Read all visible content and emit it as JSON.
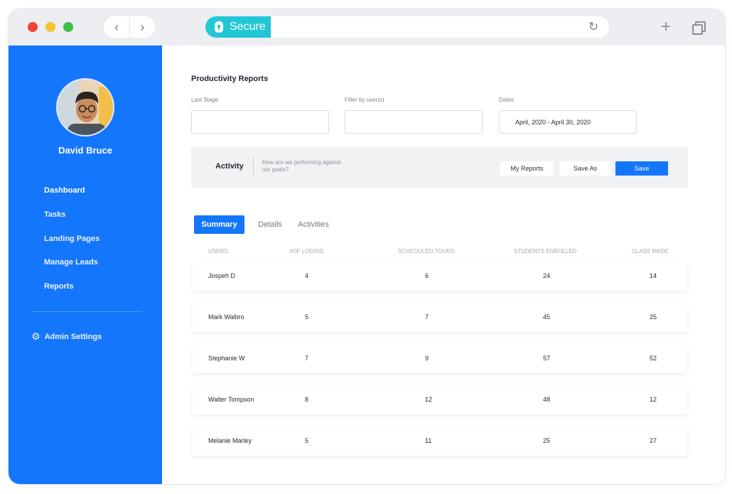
{
  "browser": {
    "secure_label": "Secure",
    "back_icon": "‹",
    "forward_icon": "›",
    "reload_icon": "↻",
    "newtab_icon": "+"
  },
  "sidebar": {
    "user_name": "David Bruce",
    "items": [
      {
        "label": "Dashboard"
      },
      {
        "label": "Tasks"
      },
      {
        "label": "Landing Pages"
      },
      {
        "label": "Manage Leads"
      },
      {
        "label": "Reports"
      }
    ],
    "admin_label": "Admin Settings"
  },
  "main": {
    "title": "Productivity Reports",
    "filters": {
      "last_stage_label": "Last Stage",
      "last_stage_value": "",
      "users_label": "Filter by user(s)",
      "users_value": "",
      "dates_label": "Dates",
      "dates_value": "April, 2020 - April 30, 2020"
    },
    "activity": {
      "title": "Activity",
      "subtitle": "How are we performing against our goals?",
      "my_reports": "My Reports",
      "save_as": "Save As",
      "save": "Save"
    },
    "tabs": [
      {
        "label": "Summary"
      },
      {
        "label": "Details"
      },
      {
        "label": "Activities"
      }
    ],
    "table": {
      "headers": [
        "USERS",
        "#OF LOGINS",
        "SCHEDULED TOURS",
        "STUDENTS ENROLLED",
        "CLASS MADE"
      ],
      "rows": [
        [
          "Jospeh D",
          "4",
          "6",
          "24",
          "14"
        ],
        [
          "Mark Walbro",
          "5",
          "7",
          "45",
          "25"
        ],
        [
          "Stephanie W",
          "7",
          "9",
          "57",
          "52"
        ],
        [
          "Walter Tompson",
          "8",
          "12",
          "48",
          "12"
        ],
        [
          "Melanie Marley",
          "5",
          "11",
          "25",
          "27"
        ]
      ]
    }
  },
  "colors": {
    "accent": "#1476fb",
    "secure": "#22c7d6"
  }
}
